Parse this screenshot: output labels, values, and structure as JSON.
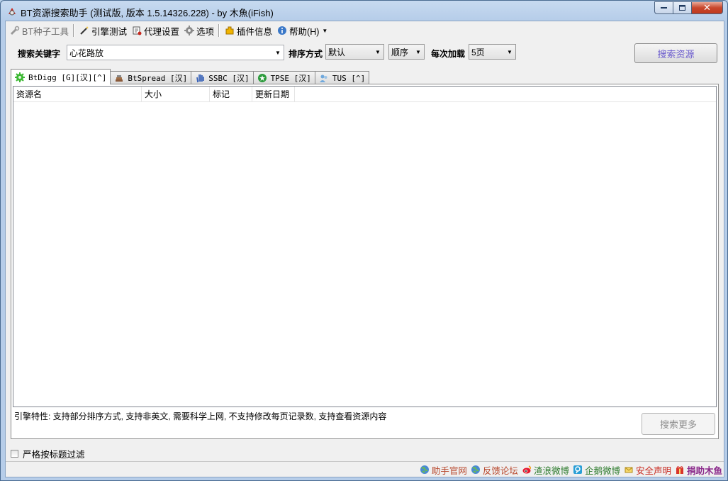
{
  "window": {
    "title": "BT资源搜索助手 (测试版, 版本 1.5.14326.228) - by 木魚(iFish)",
    "controls": {
      "minimize": "▭",
      "maximize": "▭",
      "close": "✕"
    }
  },
  "toolbar": {
    "items": [
      {
        "label": "BT种子工具",
        "icon": "tools-icon",
        "enabled": false
      },
      {
        "label": "引擎测试",
        "icon": "magic-wand-icon"
      },
      {
        "label": "代理设置",
        "icon": "proxy-settings-icon"
      },
      {
        "label": "选项",
        "icon": "gear-icon"
      },
      {
        "label": "插件信息",
        "icon": "plugin-icon"
      },
      {
        "label": "帮助(H)",
        "icon": "info-icon",
        "has_dropdown": true
      }
    ]
  },
  "search": {
    "keyword_label": "搜索关键字",
    "keyword_value": "心花路放",
    "sort_label": "排序方式",
    "sort_value": "默认",
    "order_value": "顺序",
    "per_load_label": "每次加载",
    "per_load_value": "5页",
    "search_button": "搜索资源"
  },
  "tabs": [
    {
      "label": "BtDigg [G][汉][^]",
      "icon": "green-gear-icon",
      "active": true
    },
    {
      "label": "BtSpread [汉]",
      "icon": "stack-icon"
    },
    {
      "label": "SSBC [汉]",
      "icon": "hand-icon"
    },
    {
      "label": "TPSE [汉]",
      "icon": "green-star-icon"
    },
    {
      "label": "TUS [^]",
      "icon": "users-icon"
    }
  ],
  "results": {
    "columns": [
      "资源名",
      "大小",
      "标记",
      "更新日期"
    ],
    "rows": []
  },
  "engine_note": "引擎特性: 支持部分排序方式, 支持非英文, 需要科学上网, 不支持修改每页记录数, 支持查看资源内容",
  "more_button": "搜索更多",
  "strict_filter": {
    "label": "严格按标题过滤",
    "checked": false
  },
  "status_links": [
    {
      "label": "助手官网",
      "icon": "globe-icon",
      "color": "#b8482d"
    },
    {
      "label": "反馈论坛",
      "icon": "globe-icon",
      "color": "#b8482d"
    },
    {
      "label": "渣浪微博",
      "icon": "weibo-icon",
      "color": "#2b7a2b"
    },
    {
      "label": "企鹅微博",
      "icon": "qq-weibo-icon",
      "color": "#2b7a2b"
    },
    {
      "label": "安全声明",
      "icon": "shield-icon",
      "color": "#c8281e"
    },
    {
      "label": "捐助木鱼",
      "icon": "gift-icon",
      "color": "#8b2a8b"
    }
  ],
  "colors": {
    "search_button_text": "#6a5acd",
    "link_red": "#b8482d",
    "link_green": "#2b7a2b"
  }
}
